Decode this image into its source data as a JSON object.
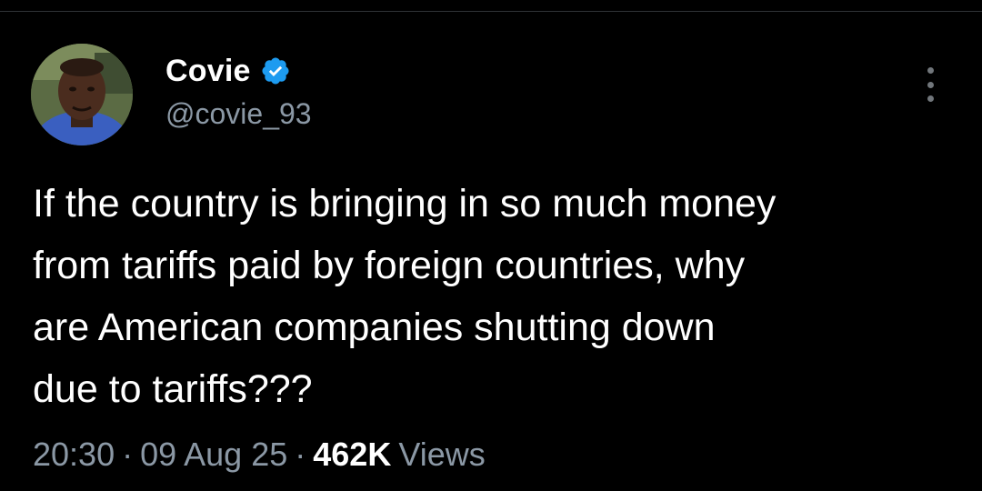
{
  "post": {
    "author": {
      "display_name": "Covie",
      "handle": "@covie_93",
      "verified": true,
      "verified_icon": "verified-badge-icon",
      "avatar_icon": "profile-avatar"
    },
    "text": "If the country is bringing in so much money\nfrom tariffs paid by foreign countries, why\nare American companies shutting down\ndue to tariffs???",
    "time": "20:30",
    "date": "09 Aug 25",
    "views_count": "462K",
    "views_label": "Views",
    "separator": "·",
    "more_icon": "more-vertical-icon"
  },
  "colors": {
    "background": "#000000",
    "text": "#ffffff",
    "secondary": "#8b98a5",
    "verified": "#1d9bf0"
  }
}
